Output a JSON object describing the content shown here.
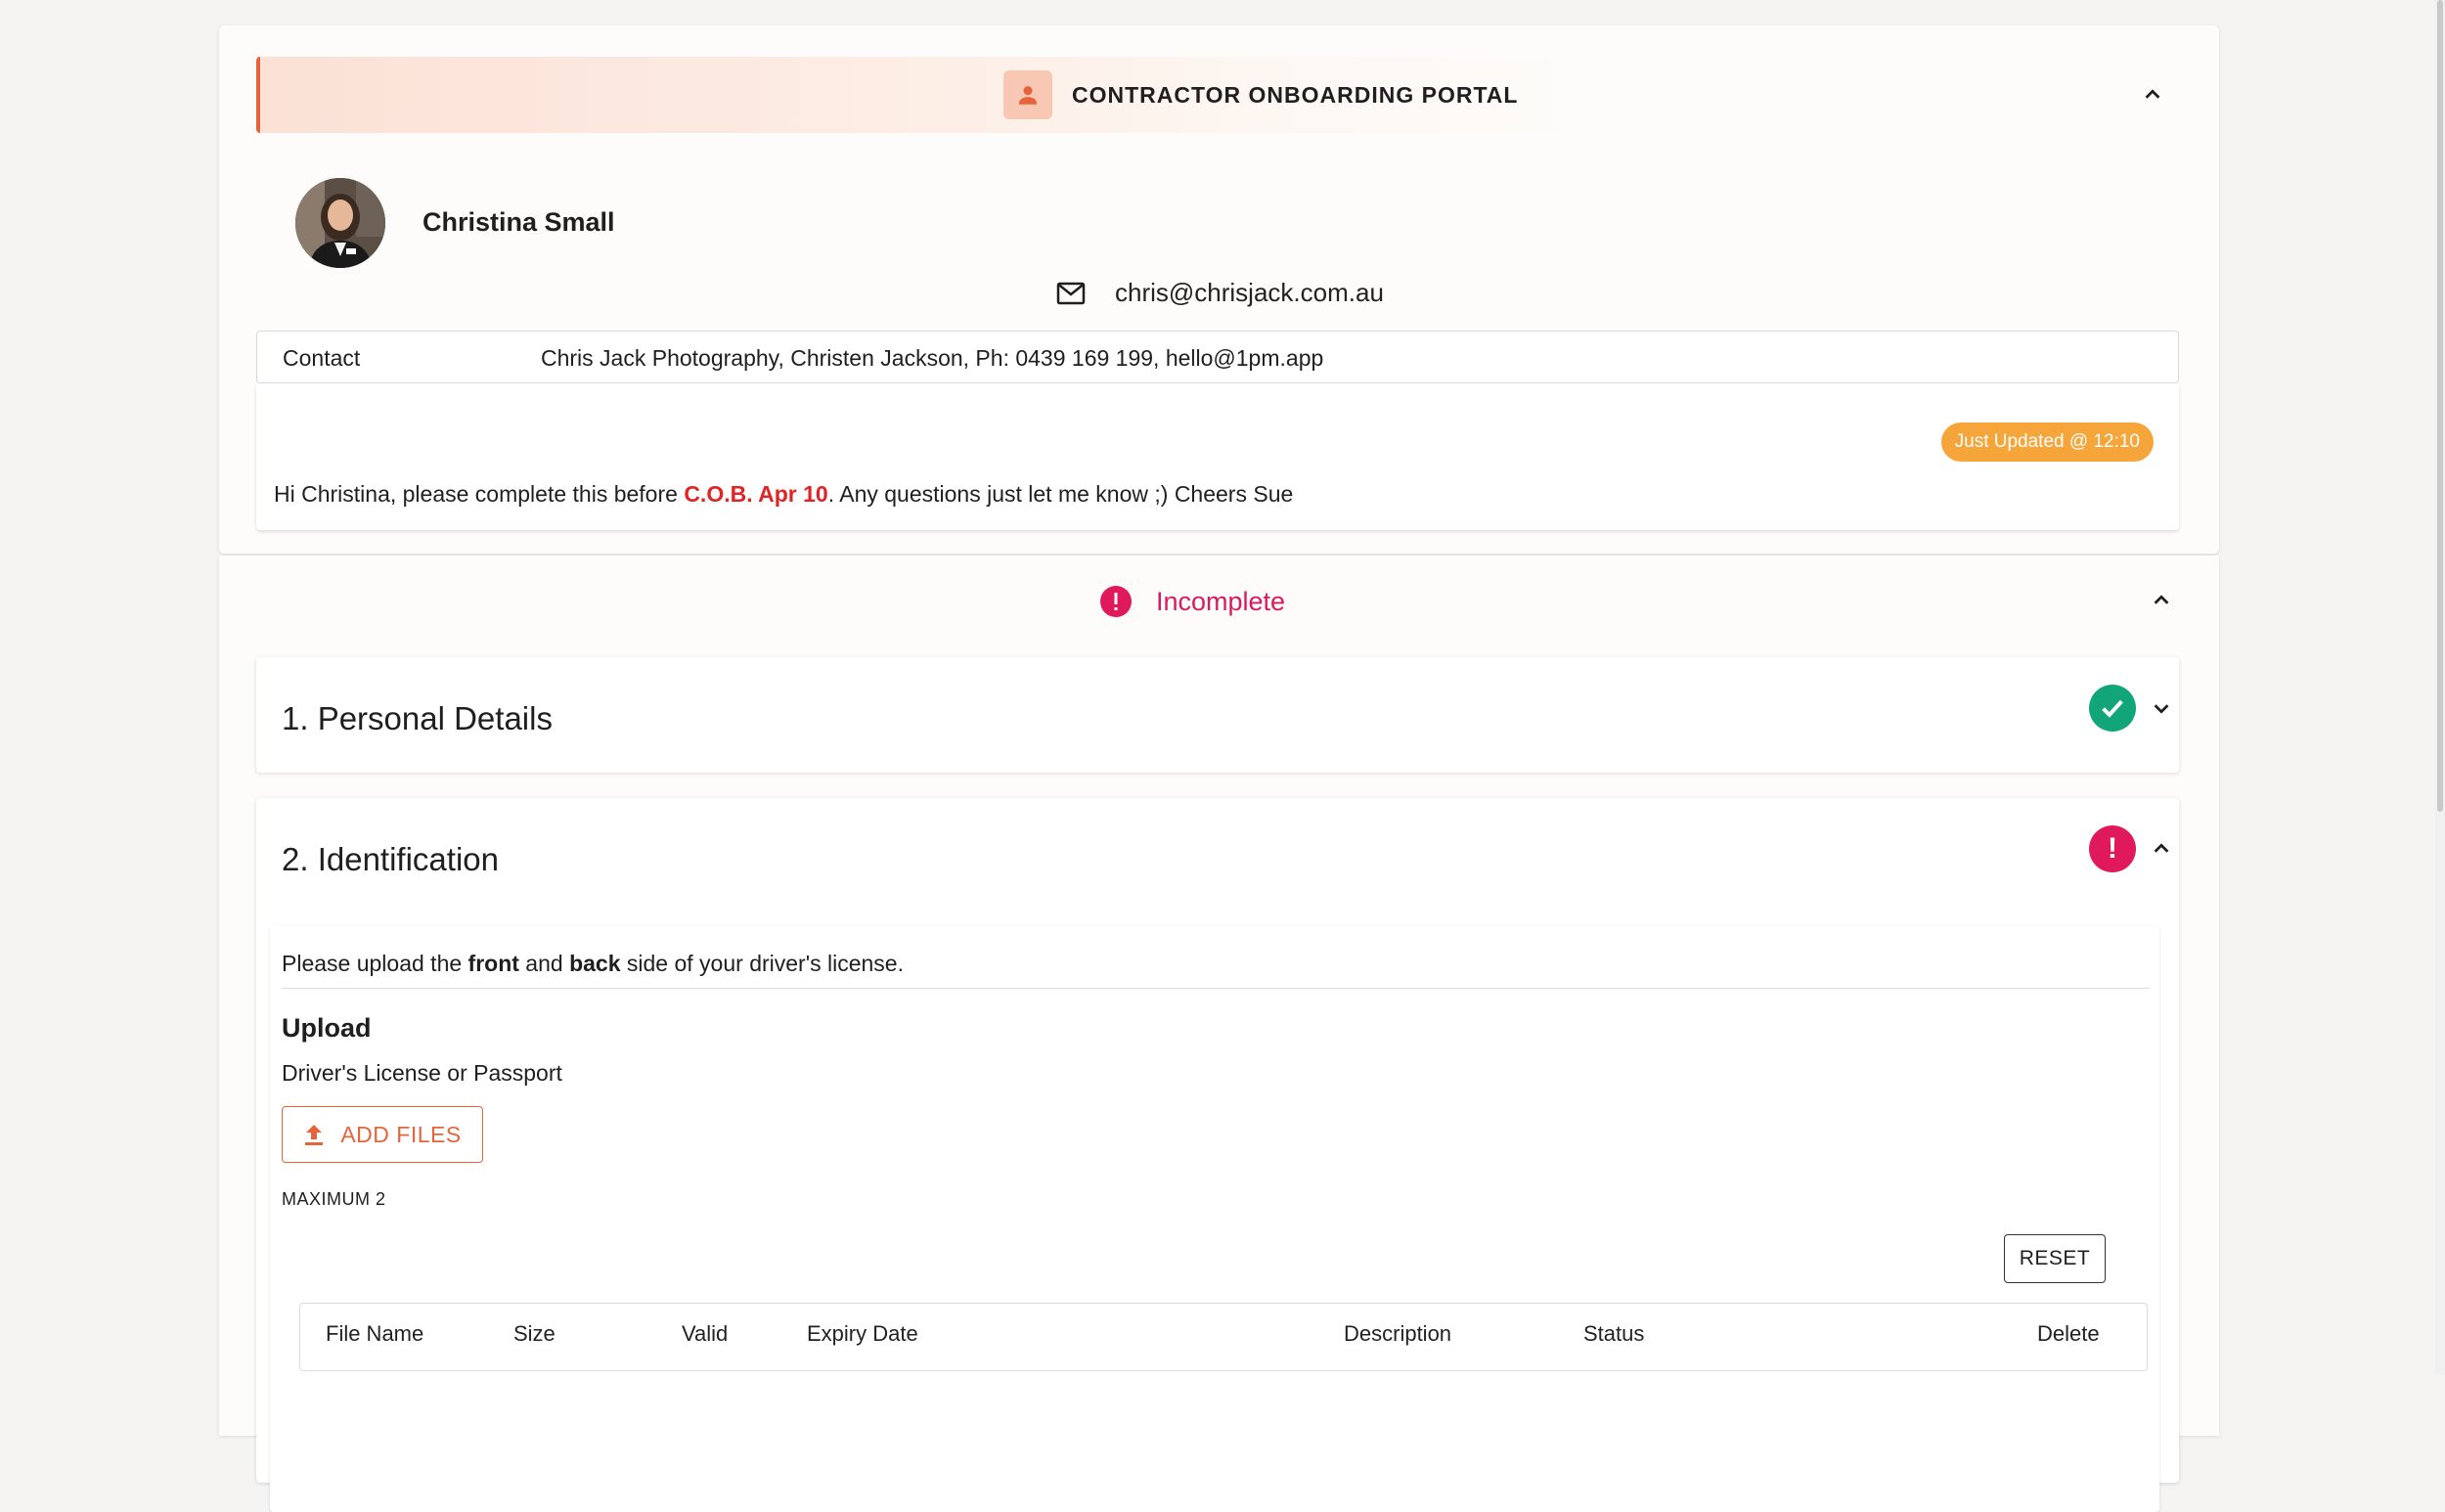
{
  "header": {
    "title": "CONTRACTOR ONBOARDING PORTAL",
    "icon": "person-icon",
    "accent": "#e6643c"
  },
  "profile": {
    "name": "Christina Small",
    "email": "chris@chrisjack.com.au"
  },
  "contact": {
    "label": "Contact",
    "value": "Chris Jack Photography, Christen Jackson, Ph: 0439 169 199, hello@1pm.app"
  },
  "message": {
    "badge": "Just Updated @ 12:10",
    "prefix": "Hi Christina, please complete this before ",
    "highlight": "C.O.B. Apr 10",
    "suffix": ". Any questions just let me know ;) Cheers Sue"
  },
  "status": {
    "text": "Incomplete",
    "color": "#d81b60"
  },
  "sections": [
    {
      "title": "1. Personal Details",
      "state": "complete"
    },
    {
      "title": "2. Identification",
      "state": "error"
    }
  ],
  "identification": {
    "instr_prefix": "Please upload the ",
    "instr_front": "front",
    "instr_and": " and ",
    "instr_back": "back",
    "instr_suffix": " side of your driver's license.",
    "upload_heading": "Upload",
    "upload_sub": "Driver's License or Passport",
    "add_files": "ADD FILES",
    "maximum": "MAXIMUM 2",
    "reset": "RESET",
    "columns": [
      "File Name",
      "Size",
      "Valid",
      "Expiry Date",
      "Description",
      "Status",
      "Delete"
    ]
  }
}
